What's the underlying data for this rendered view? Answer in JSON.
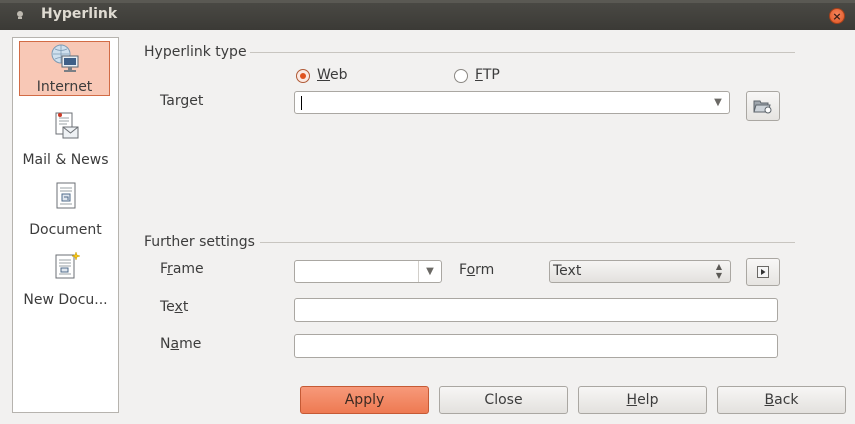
{
  "window": {
    "title": "Hyperlink"
  },
  "sidebar": {
    "items": [
      {
        "label": "Internet",
        "selected": true
      },
      {
        "label": "Mail & News",
        "selected": false
      },
      {
        "label": "Document",
        "selected": false
      },
      {
        "label": "New Docu...",
        "selected": false
      }
    ]
  },
  "hyperlink_type": {
    "heading": "Hyperlink type",
    "web_label_pre": "",
    "web_label_key": "W",
    "web_label_post": "eb",
    "ftp_label_key": "F",
    "ftp_label_post": "TP",
    "selected": "Web"
  },
  "target": {
    "label_pre": "Tar",
    "label_key": "g",
    "label_post": "et",
    "value": ""
  },
  "further_settings": {
    "heading": "Further settings",
    "frame_label_pre": "F",
    "frame_label_key": "r",
    "frame_label_post": "ame",
    "frame_value": "",
    "form_label_pre": "F",
    "form_label_key": "o",
    "form_label_post": "rm",
    "form_value": "Text",
    "text_label_pre": "Te",
    "text_label_key": "x",
    "text_label_post": "t",
    "text_value": "",
    "name_label_pre": "N",
    "name_label_key": "a",
    "name_label_post": "me",
    "name_value": ""
  },
  "buttons": {
    "apply": "Apply",
    "close": "Close",
    "help_key": "H",
    "help_post": "elp",
    "back_key": "B",
    "back_post": "ack"
  },
  "colors": {
    "accent": "#ee7a52",
    "titlebar": "#3c3b37"
  }
}
